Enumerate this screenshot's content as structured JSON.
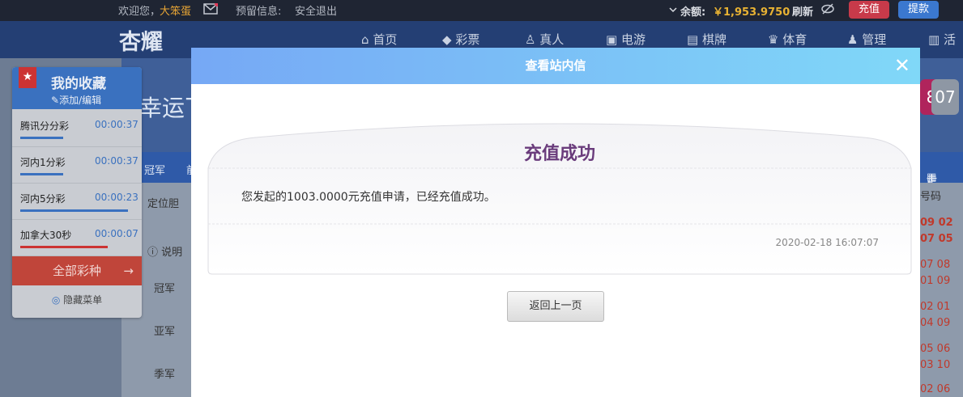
{
  "topbar": {
    "welcome": "欢迎您，",
    "username": "大笨蛋",
    "reserve_label": "预留信息:",
    "logout": "安全退出",
    "balance_label": "余额:",
    "balance_value": "￥1,953.9750",
    "refresh": "刷新",
    "deposit_button": "充值",
    "withdraw_button": "提款"
  },
  "nav": {
    "logo": "杏耀",
    "items": [
      "首页",
      "彩票",
      "真人",
      "电游",
      "棋牌",
      "体育",
      "管理",
      "活"
    ]
  },
  "banner": {
    "slogan": "幸运飞",
    "balls": [
      "8",
      "07"
    ]
  },
  "tabs": {
    "items": [
      "冠军",
      "前"
    ],
    "trend": "走势"
  },
  "panel": {
    "row_label": "定位胆",
    "info": "说明",
    "positions": [
      "冠军",
      "亚军",
      "季军"
    ],
    "col_header": "号码",
    "numbers": [
      "09 02",
      "07 05",
      "07 08",
      "01 09",
      "02 01",
      "04 09",
      "05 06",
      "03 10",
      "02 06"
    ]
  },
  "favorites": {
    "title": "我的收藏",
    "edit": "添加/编辑",
    "items": [
      {
        "name": "腾讯分分彩",
        "time": "00:00:37",
        "progress": 0.38
      },
      {
        "name": "河内1分彩",
        "time": "00:00:37",
        "progress": 0.38
      },
      {
        "name": "河内5分彩",
        "time": "00:00:23",
        "progress": 0.95
      },
      {
        "name": "加拿大30秒",
        "time": "00:00:07",
        "progress": 0.77
      }
    ],
    "all_lottery": "全部彩种",
    "hide_menu": "隐藏菜单"
  },
  "modal": {
    "title": "查看站内信",
    "card_title": "充值成功",
    "message": "您发起的1003.0000元充值申请，已经充值成功。",
    "date": "2020-02-18 16:07:07",
    "back_button": "返回上一页"
  },
  "colors": {
    "accent": "#3a71bf",
    "deposit": "#c83a4a",
    "withdraw": "#3b78cf",
    "balance": "#e8b233",
    "card_title": "#6a3c7c"
  }
}
